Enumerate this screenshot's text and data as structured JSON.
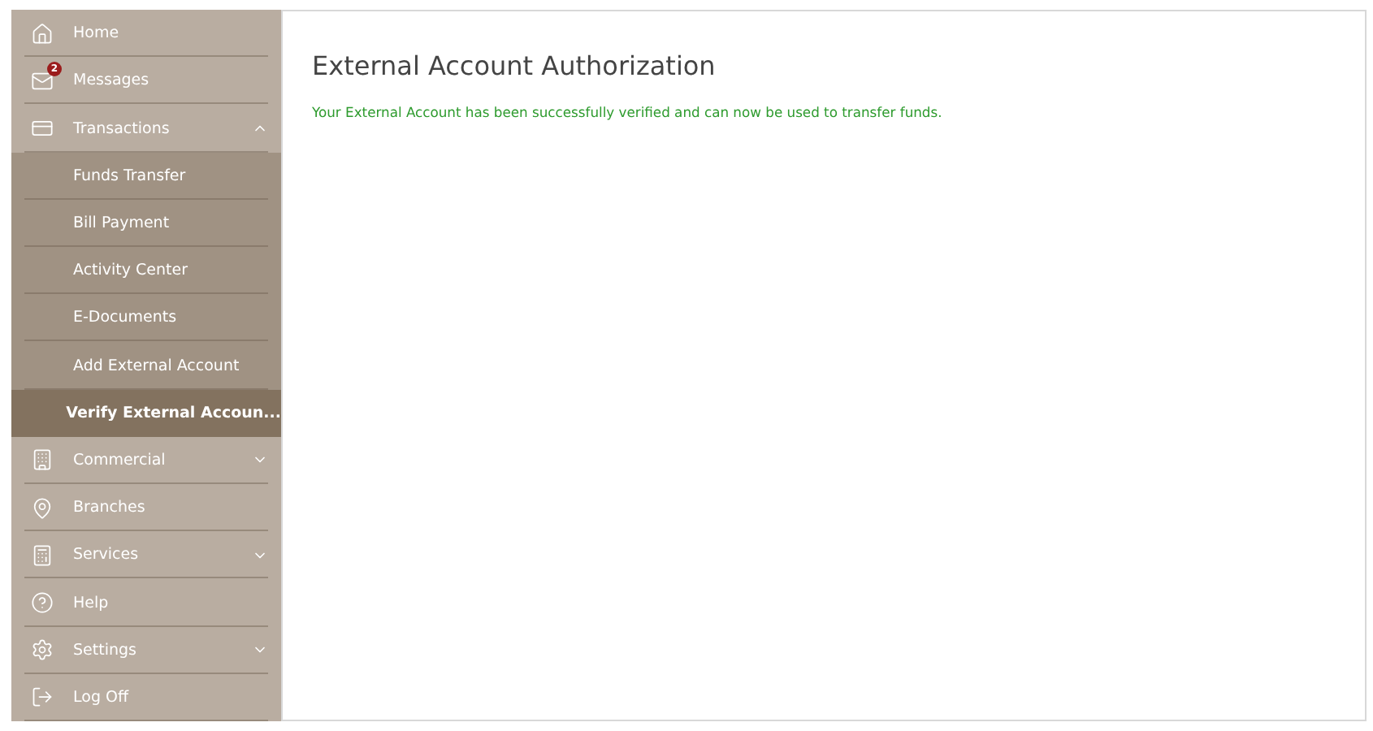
{
  "sidebar": {
    "items": [
      {
        "label": "Home"
      },
      {
        "label": "Messages",
        "badge": "2"
      },
      {
        "label": "Transactions",
        "expanded": true,
        "children": [
          {
            "label": "Funds Transfer",
            "selected": false
          },
          {
            "label": "Bill Payment",
            "selected": false
          },
          {
            "label": "Activity Center",
            "selected": false
          },
          {
            "label": "E-Documents",
            "selected": false
          },
          {
            "label": "Add External Account",
            "selected": false
          },
          {
            "label": "Verify External Accoun...",
            "selected": true
          }
        ]
      },
      {
        "label": "Commercial",
        "expanded": false
      },
      {
        "label": "Branches"
      },
      {
        "label": "Services",
        "expanded": false
      },
      {
        "label": "Help"
      },
      {
        "label": "Settings",
        "expanded": false
      },
      {
        "label": "Log Off"
      }
    ]
  },
  "main": {
    "title": "External Account Authorization",
    "message": "Your External Account has been successfully verified and can now be used to transfer funds."
  }
}
